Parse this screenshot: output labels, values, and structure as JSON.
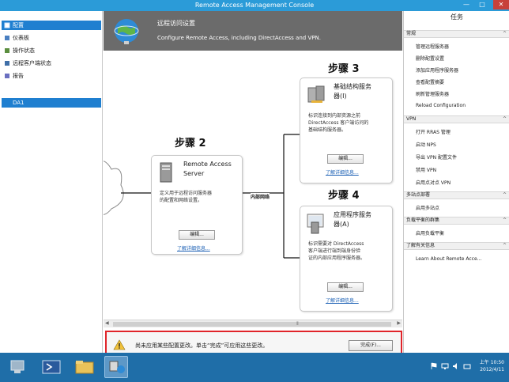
{
  "window": {
    "title": "Remote Access Management Console",
    "minimize": "—",
    "maximize": "□",
    "close": "✕"
  },
  "nav": {
    "items": [
      {
        "label": "配置",
        "icon": "gear-icon"
      },
      {
        "label": "仪表板",
        "icon": "dashboard-icon"
      },
      {
        "label": "操作状态",
        "icon": "status-icon"
      },
      {
        "label": "远程客户端状态",
        "icon": "clients-icon"
      },
      {
        "label": "报告",
        "icon": "report-icon"
      }
    ],
    "server": "DA1"
  },
  "header": {
    "title": "远程访问设置",
    "subtitle": "Configure Remote Access, including DirectAccess and VPN."
  },
  "steps": {
    "step2": {
      "label": "步骤 2",
      "title_line1": "Remote Access",
      "title_line2": "Server",
      "desc_line1": "定义用于远程访问服务器",
      "desc_line2": "的配置和网络设置。",
      "edit": "编辑...",
      "link": "了解详细信息..."
    },
    "step3": {
      "label": "步骤 3",
      "title_line1": "基础结构服务",
      "title_line2": "器(I)",
      "desc_line1": "标识连接到内部资源之前",
      "desc_line2": "DirectAccess 客户端访问的",
      "desc_line3": "基础结构服务器。",
      "edit": "编辑...",
      "link": "了解详细信息..."
    },
    "step4": {
      "label": "步骤 4",
      "title_line1": "应用程序服务",
      "title_line2": "器(A)",
      "desc_line1": "标识需要对 DirectAccess",
      "desc_line2": "客户端进行端到端身份验",
      "desc_line3": "证的内部应用程序服务器。",
      "edit": "编辑...",
      "link": "了解详细信息..."
    },
    "network_label": "内部网络"
  },
  "scrollbar": {
    "left": "◀",
    "right": "▶",
    "grip": "⦀"
  },
  "notification": {
    "message": "尚未应用某些配置更改。单击“完成”可应用这些更改。",
    "done": "完成(F)..."
  },
  "tasks": {
    "header": "任务",
    "sections": [
      {
        "name": "常规",
        "items": [
          "管理远程服务器",
          "删除配置设置",
          "添加应用程序服务器",
          "查看配置摘要",
          "刷新管理服务器",
          "Reload Configuration"
        ]
      },
      {
        "name": "VPN",
        "items": [
          "打开 RRAS 管理",
          "启动 NPS",
          "导出 VPN 配置文件",
          "禁用 VPN",
          "启用点对点 VPN"
        ]
      },
      {
        "name": "多站点部署",
        "items": [
          "启用多站点"
        ]
      },
      {
        "name": "负载平衡的群集",
        "items": [
          "启用负载平衡"
        ]
      },
      {
        "name": "了解有关信息",
        "items": [
          "Learn About Remote Acce..."
        ]
      }
    ],
    "chevron": "^"
  },
  "taskbar": {
    "time": "上午 10:50",
    "date": "2012/4/11"
  },
  "colors": {
    "titlebar": "#2b9bd8",
    "selection": "#1f7fd0",
    "header": "#6b6b6b",
    "taskbar": "#1f6ea8",
    "alert_border": "#e0242a"
  }
}
